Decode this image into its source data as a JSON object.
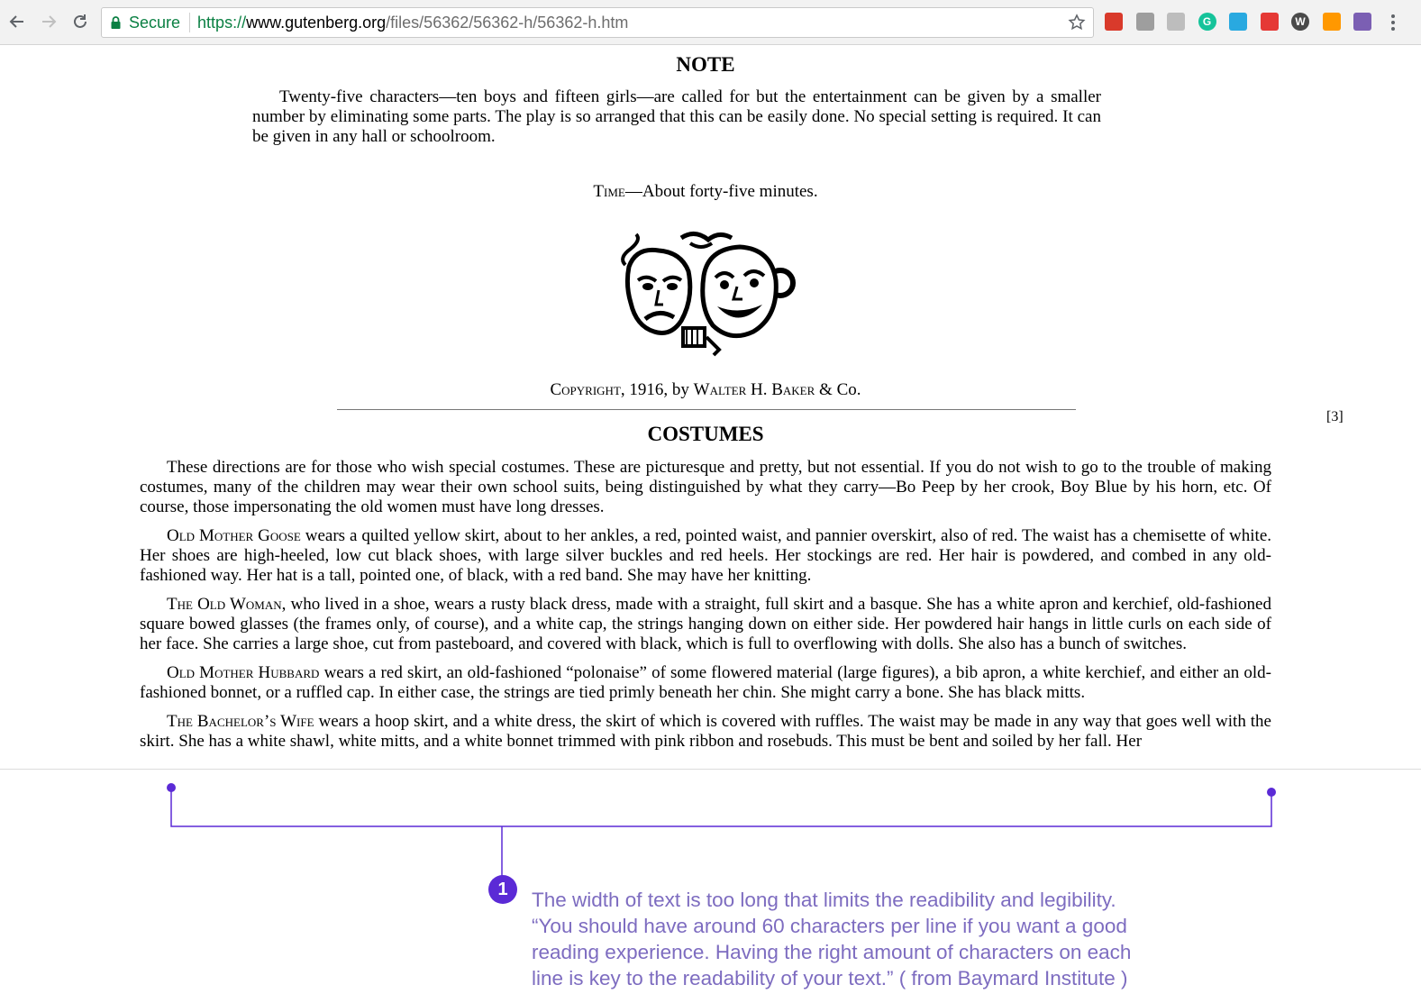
{
  "browser": {
    "secure_label": "Secure",
    "url_scheme": "https://",
    "url_host": "www.gutenberg.org",
    "url_path": "/files/56362/56362-h/56362-h.htm",
    "extensions": [
      {
        "name": "red-book-ext-icon",
        "color": "#d93a2b",
        "glyph": ""
      },
      {
        "name": "gray-box-ext-icon",
        "color": "#9e9e9e",
        "glyph": ""
      },
      {
        "name": "drive-ext-icon",
        "color": "#bdbdbd",
        "glyph": ""
      },
      {
        "name": "grammarly-ext-icon",
        "color": "#15c39a",
        "glyph": "G"
      },
      {
        "name": "note-ext-icon",
        "color": "#29a9e0",
        "glyph": ""
      },
      {
        "name": "check-ext-icon",
        "color": "#e53935",
        "glyph": ""
      },
      {
        "name": "wordpress-ext-icon",
        "color": "#4a4a4a",
        "glyph": "W"
      },
      {
        "name": "color-wheel-ext-icon",
        "color": "#ff9800",
        "glyph": ""
      },
      {
        "name": "eyedropper-ext-icon",
        "color": "#7b5fb3",
        "glyph": ""
      }
    ]
  },
  "note": {
    "title": "NOTE",
    "body": "Twenty-five characters—ten boys and fifteen girls—are called for but the entertainment can be given by a smaller number by eliminating some parts. The play is so arranged that this can be easily done. No special setting is required. It can be given in any hall or schoolroom.",
    "time_label": "Time",
    "time_text": "—About forty-five minutes."
  },
  "copyright": {
    "word": "Copyright",
    "middle": ", 1916, by ",
    "publisher": "Walter H. Baker",
    "tail": " & Co."
  },
  "page_number": "[3]",
  "costumes": {
    "title": "COSTUMES",
    "intro": "These directions are for those who wish special costumes. These are picturesque and pretty, but not essential. If you do not wish to go to the trouble of making costumes, many of the children may wear their own school suits, being distinguished by what they carry—Bo Peep by her crook, Boy Blue by his horn, etc. Of course, those impersonating the old women must have long dresses.",
    "paragraphs": [
      {
        "name": "Old Mother Goose",
        "text": " wears a quilted yellow skirt, about to her ankles, a red, pointed waist, and pannier overskirt, also of red. The waist has a chemisette of white. Her shoes are high-heeled, low cut black shoes, with large silver buckles and red heels. Her stockings are red. Her hair is powdered, and combed in any old-fashioned way. Her hat is a tall, pointed one, of black, with a red band. She may have her knitting."
      },
      {
        "name": "The Old Woman",
        "text": ", who lived in a shoe, wears a rusty black dress, made with a straight, full skirt and a basque. She has a white apron and kerchief, old-fashioned square bowed glasses (the frames only, of course), and a white cap, the strings hanging down on either side. Her powdered hair hangs in little curls on each side of her face. She carries a large shoe, cut from pasteboard, and covered with black, which is full to overflowing with dolls. She also has a bunch of switches."
      },
      {
        "name": "Old Mother Hubbard",
        "text": " wears a red skirt, an old-fashioned “polonaise” of some flowered material (large figures), a bib apron, a white kerchief, and either an old-fashioned bonnet, or a ruffled cap. In either case, the strings are tied primly beneath her chin. She might carry a bone. She has black mitts."
      },
      {
        "name": "The Bachelor’s Wife",
        "text": " wears a hoop skirt, and a white dress, the skirt of which is covered with ruffles. The waist may be made in any way that goes well with the skirt. She has a white shawl, white mitts, and a white bonnet trimmed with pink ribbon and rosebuds. This must be bent and soiled by her fall. Her"
      }
    ]
  },
  "annotation": {
    "number": "1",
    "accent": "#5b2ad6",
    "text_color": "#7d6cc0",
    "lines": [
      "The width of text is too long that limits the readibility and legibility.",
      " “You should have around 60 characters per line if you want a good",
      "reading experience. Having the right amount of characters on each",
      "line is key to the readability of your text.” ( from Baymard Institute )"
    ]
  }
}
